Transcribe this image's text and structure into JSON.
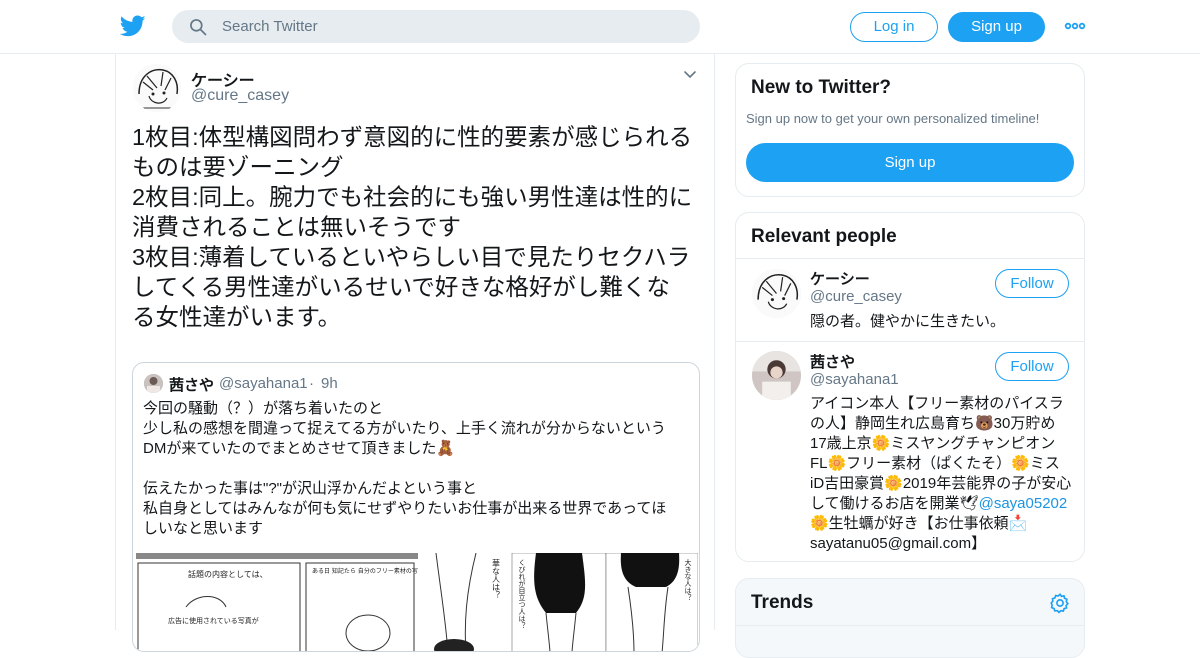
{
  "header": {
    "logo": "twitter-bird-icon",
    "search_placeholder": "Search Twitter",
    "login_label": "Log in",
    "signup_label": "Sign up",
    "more": "more-dots-icon",
    "accent_color": "#1da1f2"
  },
  "tweet": {
    "display_name": "ケーシー",
    "handle": "@cure_casey",
    "text": "1枚目:体型構図問わず意図的に性的要素が感じられる\nものは要ゾーニング\n2枚目:同上。腕力でも社会的にも強い男性達は性的に\n消費されることは無いそうです\n3枚目:薄着しているといやらしい目で見たりセクハラ\nしてくる男性達がいるせいで好きな格好がし難くな\nる女性達がいます。",
    "quote": {
      "display_name": "茜さや",
      "handle": "@sayahana1",
      "separator": "·",
      "time": "9h",
      "text": "今回の騒動（？）が落ち着いたのと\n少し私の感想を間違って捉えてる方がいたり、上手く流れが分からないという\nDMが来ていたのでまとめさせて頂きました🧸\n\n伝えたかった事は\"?\"が沢山浮かんだよという事と\n私自身としてはみんなが何も気にせずやりたいお仕事が出来る世界であってほ\nしいなと思います",
      "manga_text_1": "話題の内容としては、",
      "manga_text_2": "ある日\n知記たら\n自分のフリー素材の写真を\n話題にして使っていた",
      "manga_text_3": "広告に使用されている写真が",
      "manga_text_4": "華な人は？",
      "manga_text_5": "くびれが目立つ人は？",
      "manga_text_6": "大きな人は？"
    }
  },
  "sidebar": {
    "new_to_twitter": {
      "title": "New to Twitter?",
      "subtitle": "Sign up now to get your own personalized timeline!",
      "button": "Sign up"
    },
    "relevant_people": {
      "title": "Relevant people",
      "people": [
        {
          "name": "ケーシー",
          "handle": "@cure_casey",
          "follow": "Follow",
          "bio": "隠の者。健やかに生きたい。"
        },
        {
          "name": "茜さや",
          "handle": "@sayahana1",
          "follow": "Follow",
          "bio_1": "アイコン本人【フリー素材のパイスラの人】静岡生れ広島育ち🐻30万貯め17歳上京🌼ミスヤングチャンピオンFL🌼フリー素材（ぱくたそ）🌼ミスiD吉田豪賞🌼2019年芸能界の子が安心して働けるお店を開業🕊",
          "bio_link": "@saya05202",
          "bio_2": "🌼生牡蠣が好き【お仕事依頼📩sayatanu05@gmail.com】"
        }
      ]
    },
    "trends": {
      "title": "Trends",
      "icon": "gear-icon"
    }
  }
}
